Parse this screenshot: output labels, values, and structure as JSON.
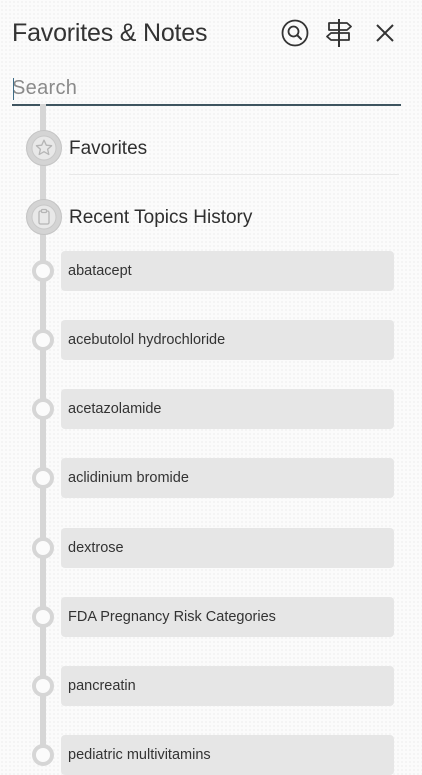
{
  "header": {
    "title": "Favorites & Notes"
  },
  "search": {
    "placeholder": "Search",
    "value": ""
  },
  "sections": {
    "favorites_label": "Favorites",
    "recent_label": "Recent Topics History"
  },
  "recent_items": [
    "abatacept",
    "acebutolol hydrochloride",
    "acetazolamide",
    "aclidinium bromide",
    "dextrose",
    "FDA Pregnancy Risk Categories",
    "pancreatin",
    "pediatric multivitamins"
  ],
  "icons": {
    "search_button": "search-icon",
    "signpost_button": "signpost-icon",
    "close_button": "close-icon",
    "favorites": "star-icon",
    "recent": "clipboard-icon"
  },
  "colors": {
    "search_underline": "#3f5560",
    "timeline": "#d6d6d6",
    "item_background": "#e6e6e6"
  }
}
